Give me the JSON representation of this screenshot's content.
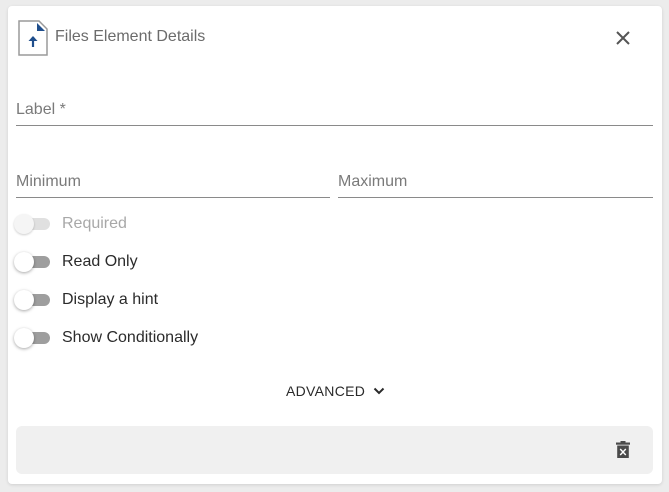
{
  "dialog": {
    "title": "Files Element Details",
    "header_icon": "file-upload-icon",
    "close_icon": "close-icon"
  },
  "fields": {
    "label": {
      "text": "Label *"
    },
    "minimum": {
      "text": "Minimum"
    },
    "maximum": {
      "text": "Maximum"
    }
  },
  "toggles": [
    {
      "label": "Required",
      "enabled": false,
      "on": false
    },
    {
      "label": "Read Only",
      "enabled": true,
      "on": false
    },
    {
      "label": "Display a hint",
      "enabled": true,
      "on": false
    },
    {
      "label": "Show Conditionally",
      "enabled": true,
      "on": false
    }
  ],
  "advanced": {
    "label": "ADVANCED",
    "icon": "chevron-down-icon"
  },
  "footer": {
    "delete_icon": "delete-icon"
  },
  "colors": {
    "icon_accent": "#1f4e8c",
    "text_muted": "#7a7a7a",
    "switch_track": "#9e9e9e"
  }
}
